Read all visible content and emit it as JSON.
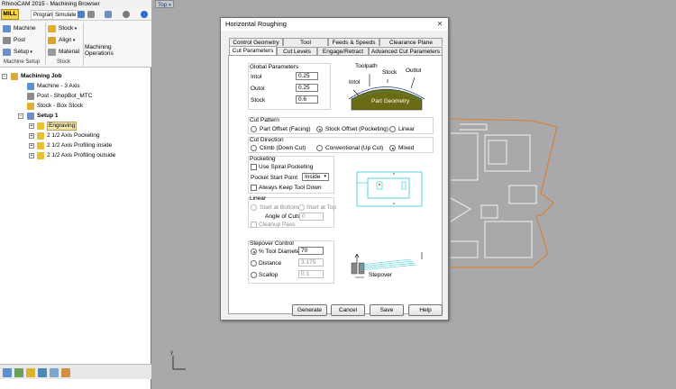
{
  "app": {
    "title": "RhinoCAM 2015 - Machining Browser",
    "tabs": [
      "MILL",
      "Program",
      "Simulate"
    ],
    "close_glyph": "✕"
  },
  "ribbon": {
    "machine": "Machine",
    "post": "Post",
    "setup": "Setup",
    "stock": "Stock",
    "align": "Align",
    "material": "Material",
    "machining_operations": [
      "Machining",
      "Operations"
    ],
    "group_machine_setup": "Machine Setup",
    "group_stock": "Stock"
  },
  "tree": {
    "root": "Machining Job",
    "machine": "Machine - 3 Axis",
    "post": "Post - ShopBot_MTC",
    "stock": "Stock - Box Stock",
    "setup": "Setup 1",
    "ops": [
      "Engraving",
      "2 1/2 Axis Pocketing",
      "2 1/2 Axis Profiling inside",
      "2 1/2 Axis Profiling outside"
    ]
  },
  "viewport": {
    "label": "Top"
  },
  "dialog": {
    "title": "Horizontal Roughing",
    "close_glyph": "✕",
    "tabs_row1": [
      "Control Geometry",
      "Tool",
      "Feeds & Speeds",
      "Clearance Plane"
    ],
    "tabs_row2": [
      "Cut Parameters",
      "Cut Levels",
      "Engage/Retract",
      "Advanced Cut Parameters"
    ],
    "global": {
      "title": "Global Parameters",
      "intol_label": "Intol",
      "intol_value": "0.25",
      "outol_label": "Outol",
      "outol_value": "0.25",
      "stock_label": "Stock",
      "stock_value": "0.6"
    },
    "diagram": {
      "toolpath": "Toolpath",
      "stock": "Stock",
      "outtol": "Outtol",
      "intol": "Intol",
      "part_geometry": "Part Geometry"
    },
    "cut_pattern": {
      "title": "Cut Pattern",
      "opt1": "Part Offset (Facing)",
      "opt2": "Stock Offset (Pocketing)",
      "opt3": "Linear"
    },
    "cut_direction": {
      "title": "Cut Direction",
      "opt1": "Climb (Down Cut)",
      "opt2": "Conventional (Up Cut)",
      "opt3": "Mixed"
    },
    "pocketing": {
      "title": "Pocketing",
      "spiral": "Use Spiral Pocketing",
      "start_label": "Pocket Start Point",
      "start_value": "Inside",
      "keep_down": "Always Keep Tool Down"
    },
    "linear": {
      "title": "Linear",
      "bottom": "Start at Bottom",
      "top": "Start at Top",
      "angle_label": "Angle of Cuts",
      "angle_value": "0",
      "cleanup": "Cleanup Pass"
    },
    "stepover": {
      "title": "Stepover Control",
      "tool_dia_label": "% Tool Diameter",
      "tool_dia_value": "70",
      "distance_label": "Distance",
      "distance_value": "3.175",
      "scallop_label": "Scallop",
      "scallop_value": "0.1",
      "diagram_label": "Stepover"
    },
    "buttons": {
      "generate": "Generate",
      "cancel": "Cancel",
      "save": "Save",
      "help": "Help"
    }
  },
  "colors": {
    "mill_tab": "#f5d24a",
    "viewport_bg": "#a9a9ab",
    "part_geometry": "#6b6b15",
    "toolpath_orange": "#e07a20",
    "cyan_preview": "#28c8d8"
  }
}
